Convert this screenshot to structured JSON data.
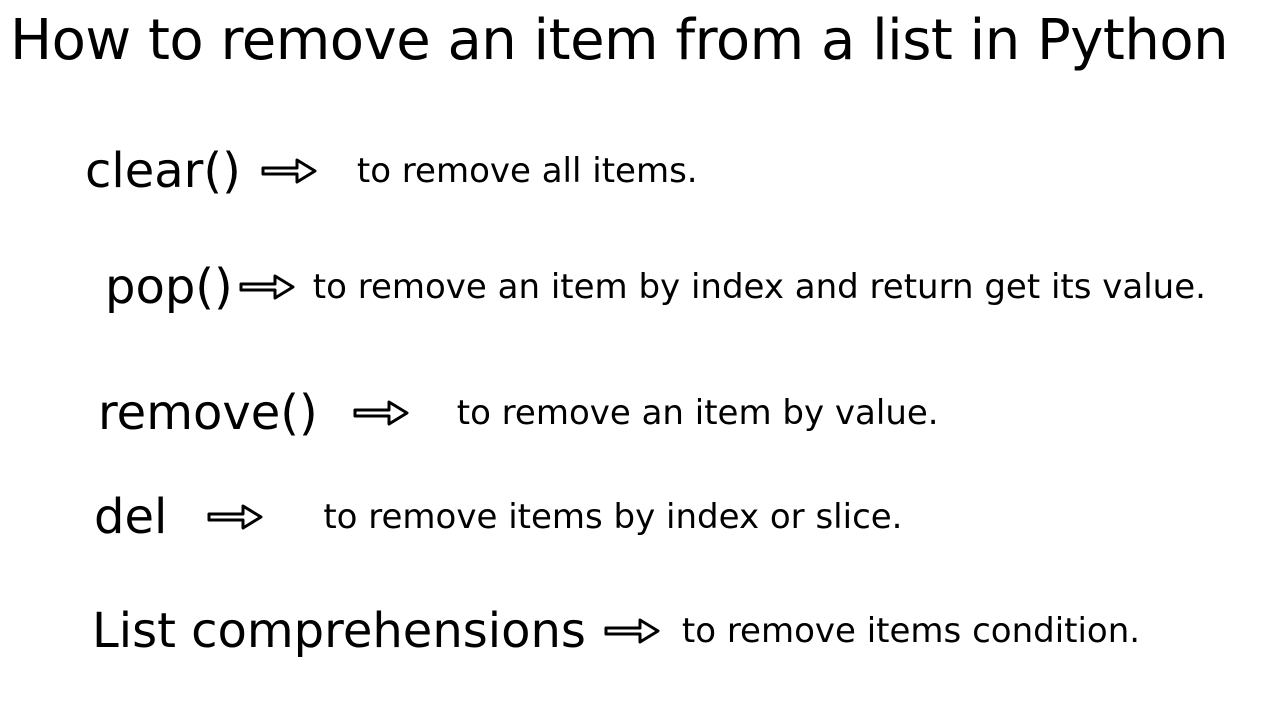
{
  "title": "How to remove an item from a list in Python",
  "rows": [
    {
      "method": "clear()",
      "desc": "to remove all items."
    },
    {
      "method": "pop()",
      "desc": "to remove an item by index and return get its value."
    },
    {
      "method": "remove()",
      "desc": "to remove an item by value."
    },
    {
      "method": "del",
      "desc": "to remove items by index or slice."
    },
    {
      "method": "List comprehensions",
      "desc": "to remove items condition."
    }
  ]
}
